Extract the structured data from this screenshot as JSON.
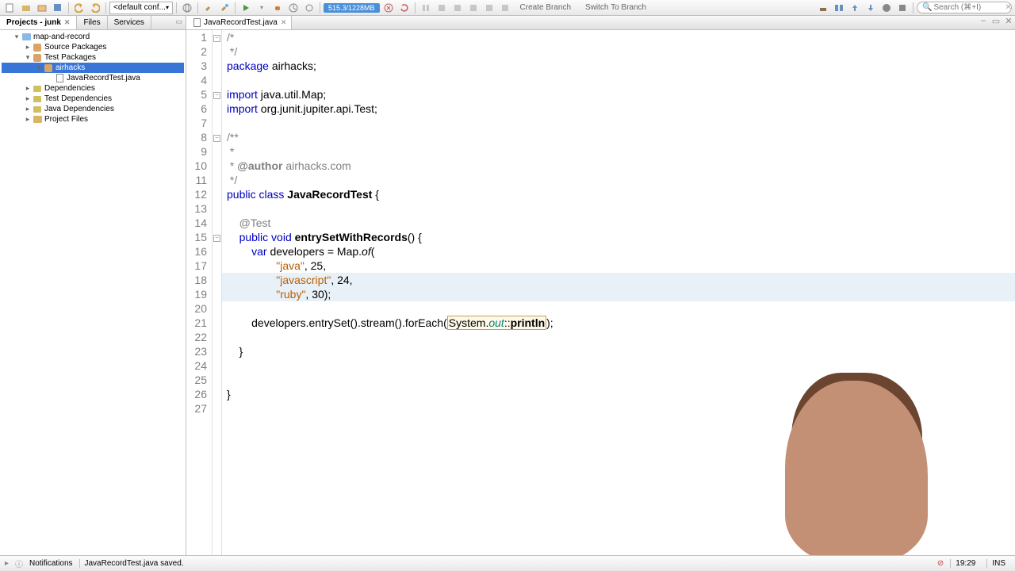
{
  "toolbar": {
    "config_combo": "<default conf...",
    "memory": "515.3/1228MB",
    "create_branch": "Create Branch",
    "switch_branch": "Switch To Branch",
    "search_placeholder": "Search (⌘+I)"
  },
  "left_panel": {
    "tabs": [
      {
        "label": "Projects - junk",
        "active": true,
        "closable": true
      },
      {
        "label": "Files",
        "active": false
      },
      {
        "label": "Services",
        "active": false
      }
    ],
    "tree": [
      {
        "indent": 1,
        "toggle": "▾",
        "icon": "proj",
        "label": "map-and-record"
      },
      {
        "indent": 2,
        "toggle": "▸",
        "icon": "pkg",
        "label": "Source Packages"
      },
      {
        "indent": 2,
        "toggle": "▾",
        "icon": "pkg",
        "label": "Test Packages"
      },
      {
        "indent": 3,
        "toggle": "▾",
        "icon": "pkg",
        "label": "airhacks",
        "selected": true
      },
      {
        "indent": 4,
        "toggle": " ",
        "icon": "file",
        "label": "JavaRecordTest.java"
      },
      {
        "indent": 2,
        "toggle": "▸",
        "icon": "lib",
        "label": "Dependencies"
      },
      {
        "indent": 2,
        "toggle": "▸",
        "icon": "lib",
        "label": "Test Dependencies"
      },
      {
        "indent": 2,
        "toggle": "▸",
        "icon": "lib",
        "label": "Java Dependencies"
      },
      {
        "indent": 2,
        "toggle": "▸",
        "icon": "folder",
        "label": "Project Files"
      }
    ]
  },
  "editor": {
    "tab_label": "JavaRecordTest.java",
    "lines": [
      {
        "n": 1,
        "fold": "−",
        "html": "<span class='com'>/*</span>"
      },
      {
        "n": 2,
        "fold": "",
        "html": "<span class='com'> */</span>"
      },
      {
        "n": 3,
        "fold": "",
        "html": "<span class='kw'>package</span> airhacks;"
      },
      {
        "n": 4,
        "fold": "",
        "html": ""
      },
      {
        "n": 5,
        "fold": "−",
        "html": "<span class='kw'>import</span> java.util.Map;"
      },
      {
        "n": 6,
        "fold": "",
        "html": "<span class='kw'>import</span> org.junit.jupiter.api.Test;"
      },
      {
        "n": 7,
        "fold": "",
        "html": ""
      },
      {
        "n": 8,
        "fold": "−",
        "html": "<span class='com'>/**</span>"
      },
      {
        "n": 9,
        "fold": "",
        "html": "<span class='com'> *</span>"
      },
      {
        "n": 10,
        "fold": "",
        "html": "<span class='com'> * <b>@author</b> airhacks.com</span>"
      },
      {
        "n": 11,
        "fold": "",
        "html": "<span class='com'> */</span>"
      },
      {
        "n": 12,
        "fold": "",
        "html": "<span class='kw'>public</span> <span class='kw'>class</span> <span class='cls'>JavaRecordTest</span> {"
      },
      {
        "n": 13,
        "fold": "",
        "html": ""
      },
      {
        "n": 14,
        "fold": "",
        "html": "    <span class='ann'>@Test</span>"
      },
      {
        "n": 15,
        "fold": "−",
        "html": "    <span class='kw'>public</span> <span class='kw'>void</span> <span class='cls'>entrySetWithRecords</span>() {"
      },
      {
        "n": 16,
        "fold": "",
        "html": "        <span class='kw'>var</span> developers = Map.<span class='mth'>of</span>("
      },
      {
        "n": 17,
        "fold": "",
        "html": "                <span class='str'>\"java\"</span>, 25,"
      },
      {
        "n": 18,
        "fold": "",
        "html": "                <span class='str'>\"javascript\"</span>, 24,",
        "hl": true
      },
      {
        "n": 19,
        "fold": "",
        "html": "                <span class='str'>\"ruby\"</span>, 30);",
        "hl": true
      },
      {
        "n": 20,
        "fold": "",
        "html": ""
      },
      {
        "n": 21,
        "fold": "",
        "html": "        developers.entrySet().stream().forEach(<span class='box'>System.<span class='itl'>out</span>::<span class='cls'>println</span></span>);"
      },
      {
        "n": 22,
        "fold": "",
        "html": ""
      },
      {
        "n": 23,
        "fold": "",
        "html": "    }"
      },
      {
        "n": 24,
        "fold": "",
        "html": ""
      },
      {
        "n": 25,
        "fold": "",
        "html": ""
      },
      {
        "n": 26,
        "fold": "",
        "html": "}"
      },
      {
        "n": 27,
        "fold": "",
        "html": ""
      }
    ]
  },
  "statusbar": {
    "notifications": "Notifications",
    "message": "JavaRecordTest.java saved.",
    "cursor": "19:29",
    "mode": "INS"
  }
}
